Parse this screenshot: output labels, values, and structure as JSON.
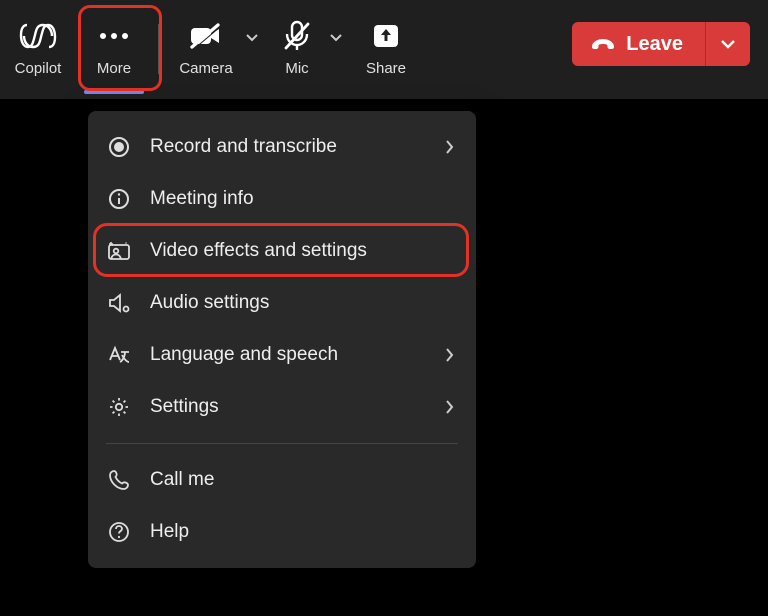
{
  "toolbar": {
    "copilot_label": "Copilot",
    "more_label": "More",
    "camera_label": "Camera",
    "mic_label": "Mic",
    "share_label": "Share",
    "leave_label": "Leave"
  },
  "menu": {
    "record_label": "Record and transcribe",
    "meeting_info_label": "Meeting info",
    "video_effects_label": "Video effects and settings",
    "audio_settings_label": "Audio settings",
    "language_label": "Language and speech",
    "settings_label": "Settings",
    "call_me_label": "Call me",
    "help_label": "Help"
  },
  "highlights": {
    "more_button": true,
    "video_effects_item": true
  }
}
